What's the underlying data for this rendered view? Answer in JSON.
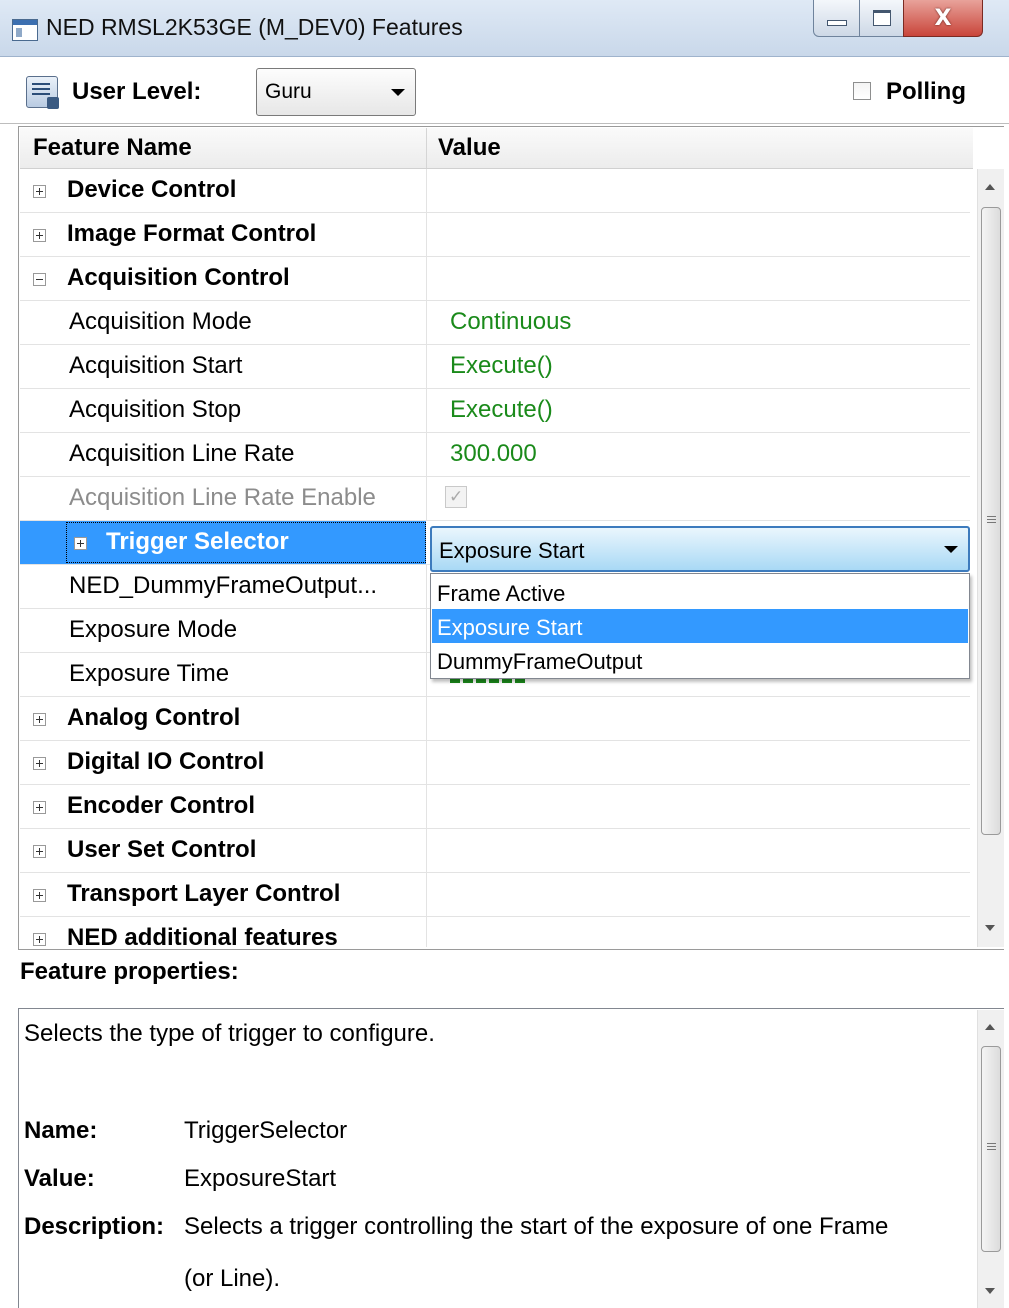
{
  "window": {
    "title": "NED RMSL2K53GE (M_DEV0) Features",
    "close_glyph": "X"
  },
  "toolbar": {
    "user_level_label": "User Level:",
    "user_level_value": "Guru",
    "polling_label": "Polling",
    "polling_checked": false
  },
  "grid": {
    "columns": [
      "Feature Name",
      "Value"
    ],
    "rows": [
      {
        "kind": "category",
        "name": "Device Control",
        "expanded": false
      },
      {
        "kind": "category",
        "name": "Image Format Control",
        "expanded": false
      },
      {
        "kind": "category",
        "name": "Acquisition Control",
        "expanded": true
      },
      {
        "kind": "feature",
        "name": "Acquisition Mode",
        "value": "Continuous"
      },
      {
        "kind": "feature",
        "name": "Acquisition Start",
        "value": "Execute()"
      },
      {
        "kind": "feature",
        "name": "Acquisition Stop",
        "value": "Execute()"
      },
      {
        "kind": "feature",
        "name": "Acquisition Line Rate",
        "value": "300.000"
      },
      {
        "kind": "feature",
        "name": "Acquisition Line Rate Enable",
        "disabled": true,
        "checkbox": true
      },
      {
        "kind": "feature",
        "name": "Trigger Selector",
        "selected": true,
        "expandable": true
      },
      {
        "kind": "feature",
        "name": "NED_DummyFrameOutput..."
      },
      {
        "kind": "feature",
        "name": "Exposure Mode"
      },
      {
        "kind": "feature",
        "name": "Exposure Time"
      },
      {
        "kind": "category",
        "name": "Analog Control",
        "expanded": false
      },
      {
        "kind": "category",
        "name": "Digital IO Control",
        "expanded": false
      },
      {
        "kind": "category",
        "name": "Encoder Control",
        "expanded": false
      },
      {
        "kind": "category",
        "name": "User Set Control",
        "expanded": false
      },
      {
        "kind": "category",
        "name": "Transport Layer Control",
        "expanded": false
      },
      {
        "kind": "category",
        "name": "NED additional features",
        "expanded": false
      }
    ]
  },
  "trigger_dropdown": {
    "current": "Exposure Start",
    "options": [
      "Frame Active",
      "Exposure Start",
      "DummyFrameOutput"
    ],
    "highlighted_index": 1
  },
  "properties": {
    "title": "Feature properties:",
    "summary": "Selects the type of trigger to configure.",
    "name_label": "Name:",
    "name_value": "TriggerSelector",
    "value_label": "Value:",
    "value_value": "ExposureStart",
    "description_label": "Description:",
    "description_line1": "Selects a trigger controlling the start of the exposure of one Frame",
    "description_line2": "(or Line)."
  },
  "colors": {
    "selection": "#3399ff",
    "value_text": "#1a8a1a",
    "disabled_text": "#8c8c8c"
  }
}
